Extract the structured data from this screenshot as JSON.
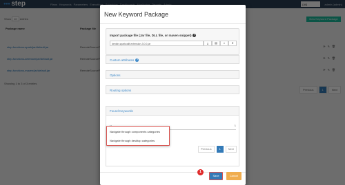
{
  "app": {
    "brand": "step",
    "nav": [
      "Plans",
      "Keywords",
      "Parameters",
      "Executions",
      "Scheduler",
      "Dashboards",
      "Monitoring",
      "Tenants",
      "Admin"
    ],
    "tenant": "[All]",
    "user": "admin (admin)"
  },
  "background": {
    "show_label": "Show",
    "show_value": "10",
    "entries_label": "entries",
    "new_button": "New Keyword Package",
    "columns": [
      "Package name",
      "Package file"
    ],
    "rows": [
      {
        "name": "step-functions-spark/jar/default.jar",
        "type": "RemoteSourceFiles"
      },
      {
        "name": "step-functions-selenium/jar/default.jar",
        "type": "RemoteSourceFiles"
      },
      {
        "name": "step-functions-maven/jar/default.jar",
        "type": "RemoteSourceFiles"
      }
    ],
    "footer": "Showing 1 to 3 of 3 entries",
    "pager": [
      "Previous",
      "1",
      "Next"
    ]
  },
  "modal": {
    "title": "New Keyword Package",
    "import_label": "Import package file (Jar file, DLL file, or maven snippet)",
    "file_value": "denkin-sparkcalif-extension-3.0.0.jar",
    "sections": {
      "custom_attributes": "Custom attributes",
      "options": "Options",
      "routing_options": "Routing options"
    },
    "found_keywords": {
      "title": "Found Keywords",
      "column": "Name",
      "sort_indicator": "⇅",
      "dropdown_items": [
        "Navigate through components categories",
        "Navigate through desktop categories"
      ],
      "pager": {
        "previous": "Previous",
        "page": "1",
        "next": "Next"
      }
    },
    "save_label": "Save",
    "cancel_label": "Cancel",
    "step_number": "1"
  },
  "colors": {
    "accent": "#337ab7",
    "highlight": "#d9534f",
    "cancel": "#f0ad4e",
    "topnav": "#2a3f54"
  }
}
